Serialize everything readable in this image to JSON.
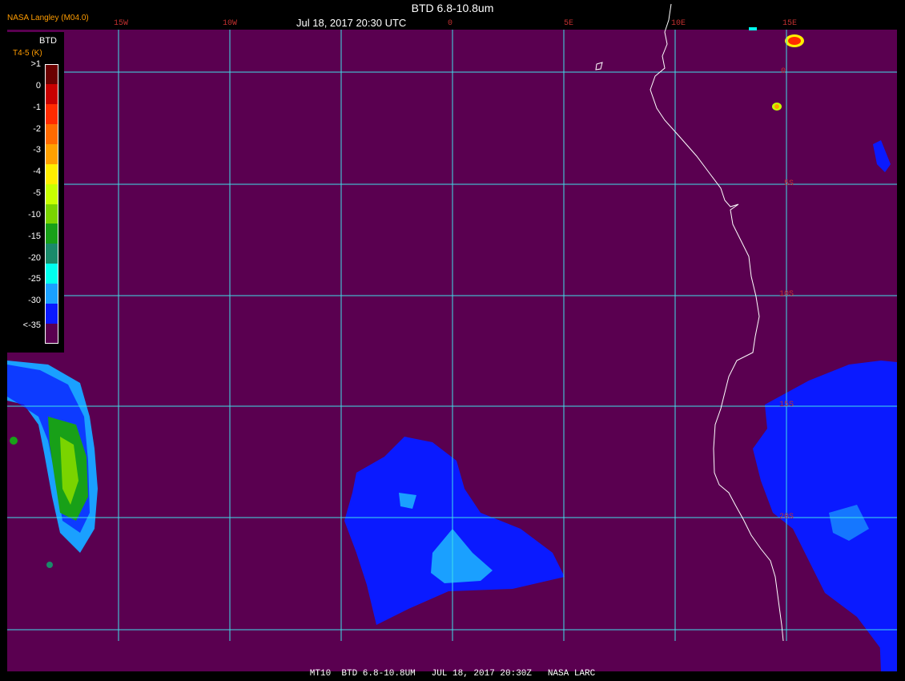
{
  "header": {
    "title": "BTD 6.8-10.8um",
    "datetime": "Jul 18, 2017 20:30 UTC",
    "credit": "NASA Langley (M04.0)"
  },
  "longitude_labels": [
    "15W",
    "10W",
    "0",
    "5E",
    "10E",
    "15E"
  ],
  "latitude_labels": [
    "0",
    "5S",
    "10S",
    "15S",
    "20S"
  ],
  "legend": {
    "title": "BTD",
    "subtitle": "T4-5 (K)",
    "labels": [
      ">1",
      "0",
      "-1",
      "-2",
      "-3",
      "-4",
      "-5",
      "-10",
      "-15",
      "-20",
      "-25",
      "-30",
      "<-35"
    ],
    "colors": [
      "#6b0000",
      "#c80000",
      "#ff2b00",
      "#ff6a00",
      "#ffa000",
      "#ffee00",
      "#c8ff00",
      "#7ad400",
      "#18a018",
      "#1a8a6a",
      "#00ffee",
      "#1aa0ff",
      "#0a1aff",
      "#5a0050"
    ]
  },
  "footer": "MT10  BTD 6.8-10.8UM   JUL 18, 2017 20:30Z   NASA LARC",
  "colors": {
    "background": "#5a0050",
    "grid": "#40e0e8",
    "coast": "#ffffff",
    "cloud_blue": "#0a1aff",
    "cloud_light": "#1aa0ff"
  }
}
